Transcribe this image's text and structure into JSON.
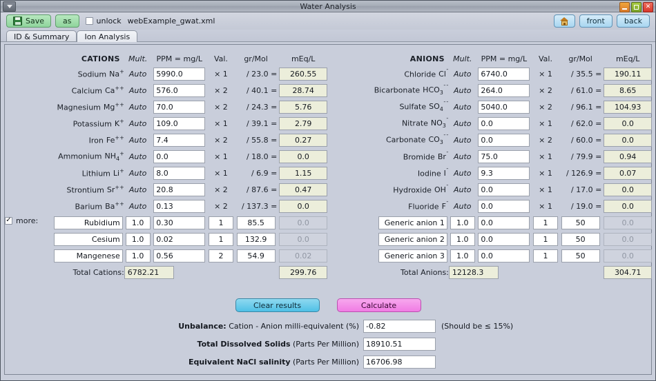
{
  "window": {
    "title": "Water Analysis",
    "controls": {
      "minimize": "minimize",
      "maximize": "maximize",
      "close": "close"
    },
    "menu_icon": "window-menu-icon"
  },
  "toolbar": {
    "save_label": "Save",
    "as_label": "as",
    "unlock_label": "unlock",
    "unlock_checked": false,
    "filename": "webExample_gwat.xml",
    "home_label": "home",
    "front_label": "front",
    "back_label": "back"
  },
  "tabs": [
    {
      "label": "ID & Summary",
      "active": false
    },
    {
      "label": "Ion Analysis",
      "active": true
    }
  ],
  "columns": {
    "mult": "Mult.",
    "ppm": "PPM = mg/L",
    "val": "Val.",
    "grmol": "gr/Mol",
    "meq": "mEq/L"
  },
  "cations": {
    "heading": "CATIONS",
    "rows": [
      {
        "name": "Sodium",
        "symbol": "Na",
        "charge": "+",
        "sub": "",
        "mult": "Auto",
        "ppm": "5990.0",
        "val": "× 1",
        "mol": "/ 23.0 =",
        "meq": "260.55"
      },
      {
        "name": "Calcium",
        "symbol": "Ca",
        "charge": "++",
        "sub": "",
        "mult": "Auto",
        "ppm": "576.0",
        "val": "× 2",
        "mol": "/ 40.1 =",
        "meq": "28.74"
      },
      {
        "name": "Magnesium",
        "symbol": "Mg",
        "charge": "++",
        "sub": "",
        "mult": "Auto",
        "ppm": "70.0",
        "val": "× 2",
        "mol": "/ 24.3 =",
        "meq": "5.76"
      },
      {
        "name": "Potassium",
        "symbol": "K",
        "charge": "+",
        "sub": "",
        "mult": "Auto",
        "ppm": "109.0",
        "val": "× 1",
        "mol": "/ 39.1 =",
        "meq": "2.79"
      },
      {
        "name": "Iron",
        "symbol": "Fe",
        "charge": "++",
        "sub": "",
        "mult": "Auto",
        "ppm": "7.4",
        "val": "× 2",
        "mol": "/ 55.8 =",
        "meq": "0.27"
      },
      {
        "name": "Ammonium",
        "symbol": "NH",
        "charge": "+",
        "sub": "4",
        "mult": "Auto",
        "ppm": "0.0",
        "val": "× 1",
        "mol": "/ 18.0 =",
        "meq": "0.0"
      },
      {
        "name": "Lithium",
        "symbol": "Li",
        "charge": "+",
        "sub": "",
        "mult": "Auto",
        "ppm": "8.0",
        "val": "× 1",
        "mol": "/ 6.9 =",
        "meq": "1.15"
      },
      {
        "name": "Strontium",
        "symbol": "Sr",
        "charge": "++",
        "sub": "",
        "mult": "Auto",
        "ppm": "20.8",
        "val": "× 2",
        "mol": "/ 87.6 =",
        "meq": "0.47"
      },
      {
        "name": "Barium",
        "symbol": "Ba",
        "charge": "++",
        "sub": "",
        "mult": "Auto",
        "ppm": "0.13",
        "val": "× 2",
        "mol": "/ 137.3 =",
        "meq": "0.0"
      }
    ],
    "more_label": "more:",
    "more_checked": true,
    "extra_rows": [
      {
        "name": "Rubidium",
        "mult": "1.0",
        "ppm": "0.30",
        "val": "1",
        "mol": "85.5",
        "meq": "0.0"
      },
      {
        "name": "Cesium",
        "mult": "1.0",
        "ppm": "0.02",
        "val": "1",
        "mol": "132.9",
        "meq": "0.0"
      },
      {
        "name": "Mangenese",
        "mult": "1.0",
        "ppm": "0.56",
        "val": "2",
        "mol": "54.9",
        "meq": "0.02"
      }
    ],
    "total_label": "Total Cations:",
    "total_ppm": "6782.21",
    "total_meq": "299.76"
  },
  "anions": {
    "heading": "ANIONS",
    "rows": [
      {
        "name": "Chloride",
        "symbol": "Cl",
        "charge": "¯",
        "sub": "",
        "mult": "Auto",
        "ppm": "6740.0",
        "val": "× 1",
        "mol": "/ 35.5 =",
        "meq": "190.11"
      },
      {
        "name": "Bicarbonate",
        "symbol": "HCO",
        "charge": "¯¯",
        "sub": "3",
        "mult": "Auto",
        "ppm": "264.0",
        "val": "× 2",
        "mol": "/ 61.0 =",
        "meq": "8.65"
      },
      {
        "name": "Sulfate",
        "symbol": "SO",
        "charge": "¯¯",
        "sub": "4",
        "mult": "Auto",
        "ppm": "5040.0",
        "val": "× 2",
        "mol": "/ 96.1 =",
        "meq": "104.93"
      },
      {
        "name": "Nitrate",
        "symbol": "NO",
        "charge": "¯",
        "sub": "3",
        "mult": "Auto",
        "ppm": "0.0",
        "val": "× 1",
        "mol": "/ 62.0 =",
        "meq": "0.0"
      },
      {
        "name": "Carbonate",
        "symbol": "CO",
        "charge": "¯¯",
        "sub": "3",
        "mult": "Auto",
        "ppm": "0.0",
        "val": "× 2",
        "mol": "/ 60.0 =",
        "meq": "0.0"
      },
      {
        "name": "Bromide",
        "symbol": "Br",
        "charge": "¯",
        "sub": "",
        "mult": "Auto",
        "ppm": "75.0",
        "val": "× 1",
        "mol": "/ 79.9 =",
        "meq": "0.94"
      },
      {
        "name": "Iodine",
        "symbol": "I",
        "charge": "¯",
        "sub": "",
        "mult": "Auto",
        "ppm": "9.3",
        "val": "× 1",
        "mol": "/ 126.9 =",
        "meq": "0.07"
      },
      {
        "name": "Hydroxide",
        "symbol": "OH",
        "charge": "¯",
        "sub": "",
        "mult": "Auto",
        "ppm": "0.0",
        "val": "× 1",
        "mol": "/ 17.0 =",
        "meq": "0.0"
      },
      {
        "name": "Fluoride",
        "symbol": "F",
        "charge": "¯",
        "sub": "",
        "mult": "Auto",
        "ppm": "0.0",
        "val": "× 1",
        "mol": "/ 19.0 =",
        "meq": "0.0"
      }
    ],
    "extra_rows": [
      {
        "name": "Generic anion 1",
        "mult": "1.0",
        "ppm": "0.0",
        "val": "1",
        "mol": "50",
        "meq": "0.0"
      },
      {
        "name": "Generic anion 2",
        "mult": "1.0",
        "ppm": "0.0",
        "val": "1",
        "mol": "50",
        "meq": "0.0"
      },
      {
        "name": "Generic anion 3",
        "mult": "1.0",
        "ppm": "0.0",
        "val": "1",
        "mol": "50",
        "meq": "0.0"
      }
    ],
    "total_label": "Total Anions:",
    "total_ppm": "12128.3",
    "total_meq": "304.71"
  },
  "actions": {
    "clear_label": "Clear results",
    "calculate_label": "Calculate"
  },
  "results": {
    "unbalance_label_bold": "Unbalance:",
    "unbalance_label_rest": "Cation - Anion milli-equivalent (%)",
    "unbalance_value": "-0.82",
    "unbalance_note": "(Should be ≤ 15%)",
    "tds_label_bold": "Total Dissolved Solids",
    "tds_label_rest": "(Parts Per Million)",
    "tds_value": "18910.51",
    "nacl_label_bold": "Equivalent NaCl salinity",
    "nacl_label_rest": "(Parts Per Million)",
    "nacl_value": "16706.98"
  },
  "colors": {
    "accent_green": "#8fd49c",
    "accent_blue": "#4fc0e6",
    "accent_pink": "#f07ce4",
    "readonly_bg": "#eceedb",
    "panel_bg": "#c9cedb"
  }
}
